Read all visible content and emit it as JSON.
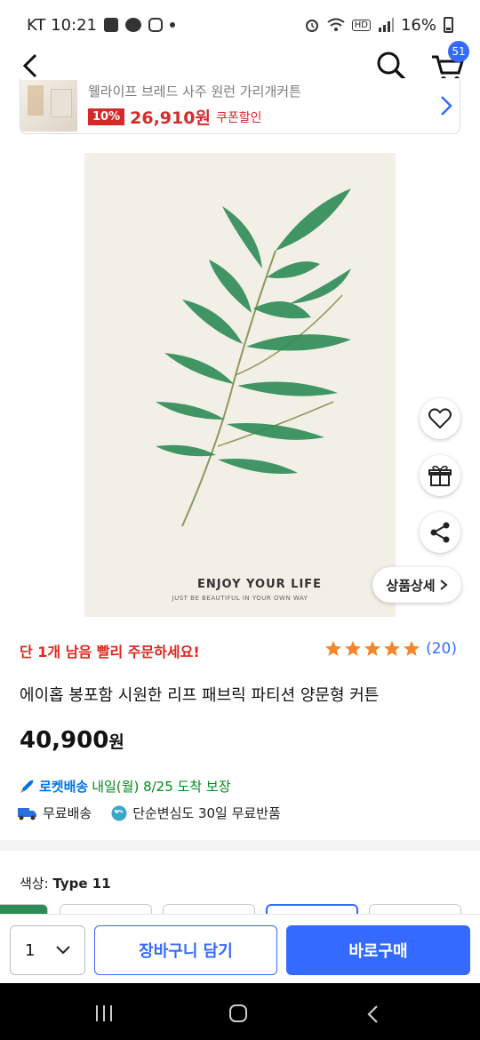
{
  "status_bar": {
    "time": "KT 10:21",
    "hd": "HD",
    "battery": "16%"
  },
  "header": {
    "cart_count": "51"
  },
  "promo": {
    "name": "웰라이프 브레드 사주 원런 가리개커튼",
    "discount": "10%",
    "price": "26,910원",
    "coupon": "쿠폰할인"
  },
  "image": {
    "caption_title": "ENJOY YOUR LIFE",
    "caption_sub": "JUST BE BEAUTIFUL IN YOUR OWN WAY"
  },
  "detail_button": "상품상세",
  "product": {
    "urgency": "단 1개 남음 빨리 주문하세요!",
    "rating_stars": 5,
    "review_count": "(20)",
    "title": "에이홉 봉포함 시원한 리프 패브릭 파티션 양문형 커튼",
    "price_number": "40,900",
    "price_unit": "원"
  },
  "delivery": {
    "rocket_label": "로켓배송",
    "arrival": "내일(월) 8/25 도착 보장",
    "free_shipping": "무료배송",
    "free_return": "단순변심도 30일 무료반품"
  },
  "options": {
    "color_label": "색상:",
    "color_value": "Type 11"
  },
  "bottom_bar": {
    "quantity": "1",
    "add_to_cart": "장바구니 담기",
    "buy_now": "바로구매"
  },
  "colors": {
    "accent": "#346aff",
    "urgent_red": "#e0261c",
    "rocket_blue": "#0073e9",
    "arrival_green": "#00891a",
    "star": "#f5862b"
  }
}
